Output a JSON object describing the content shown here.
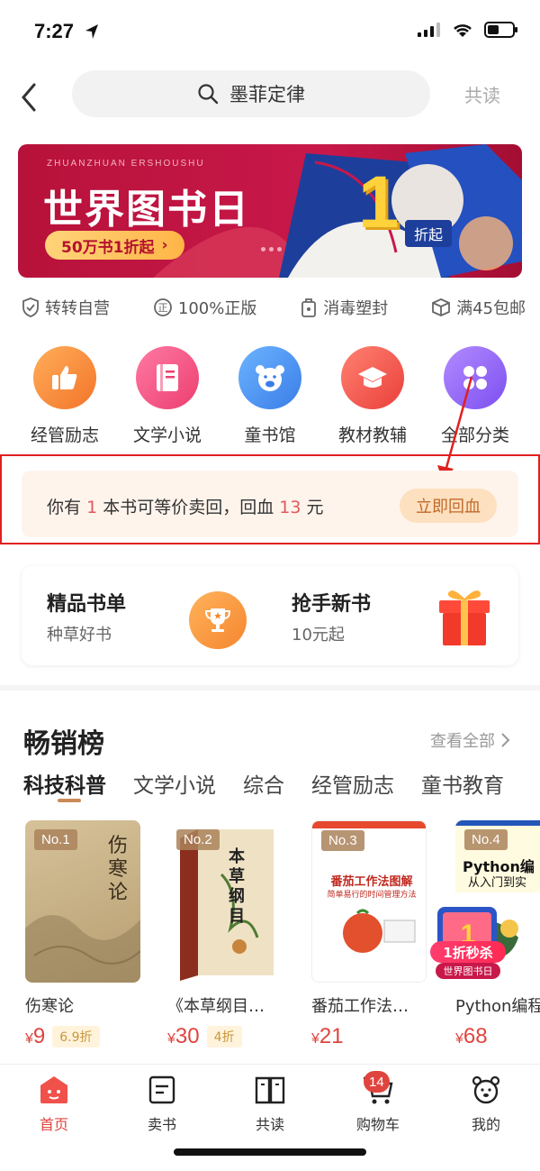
{
  "status_bar": {
    "time": "7:27"
  },
  "header": {
    "search_text": "墨菲定律",
    "right_label": "共读"
  },
  "banner": {
    "subtitle": "ZHUANZHUAN ERSHOUSHU",
    "title": "世界图书日",
    "pill_label": "50万书1折起",
    "big_number": "1",
    "discount_label": "折起"
  },
  "features": [
    {
      "label": "转转自营",
      "icon": "shield-check-icon"
    },
    {
      "label": "100%正版",
      "icon": "genuine-icon"
    },
    {
      "label": "消毒塑封",
      "icon": "seal-bag-icon"
    },
    {
      "label": "满45包邮",
      "icon": "package-icon"
    }
  ],
  "categories": [
    {
      "label": "经管励志",
      "icon": "thumbs-up-icon",
      "color": "#f5853a"
    },
    {
      "label": "文学小说",
      "icon": "book-icon",
      "color": "#f0457a"
    },
    {
      "label": "童书馆",
      "icon": "bear-icon",
      "color": "#3d8ef0"
    },
    {
      "label": "教材教辅",
      "icon": "graduation-cap-icon",
      "color": "#f0524a"
    },
    {
      "label": "全部分类",
      "icon": "grid-icon",
      "color": "#8a5cf0"
    }
  ],
  "resell": {
    "text_prefix": "你有",
    "count": "1",
    "text_middle": "本书可等价卖回，回血",
    "amount": "13",
    "text_suffix": "元",
    "button_label": "立即回血"
  },
  "promo": {
    "left_title": "精品书单",
    "left_sub": "种草好书",
    "right_title": "抢手新书",
    "right_sub": "10元起"
  },
  "ranking": {
    "title": "畅销榜",
    "view_all": "查看全部",
    "tabs": [
      "科技科普",
      "文学小说",
      "综合",
      "经管励志",
      "童书教育"
    ],
    "books": [
      {
        "rank": "No.1",
        "title": "伤寒论",
        "price": "9",
        "discount": "6.9折"
      },
      {
        "rank": "No.2",
        "title": "《本草纲目…",
        "price": "30",
        "discount": "4折"
      },
      {
        "rank": "No.3",
        "title": "番茄工作法…",
        "price": "21",
        "discount": ""
      },
      {
        "rank": "No.4",
        "title": "Python编程",
        "price": "68",
        "discount": ""
      }
    ],
    "currency": "¥"
  },
  "book_cover_text": {
    "b1": "伤寒论",
    "b2": "本草纲目",
    "b3_line1": "番茄工作法图解",
    "b3_line2": "简单易行的时间管理方法",
    "b4_line1": "Python编",
    "b4_line2": "从入门到实",
    "flash_sale": "1折秒杀",
    "flash_sale_sub": "世界图书日"
  },
  "bottom_nav": [
    {
      "label": "首页",
      "icon": "home-icon",
      "active": true
    },
    {
      "label": "卖书",
      "icon": "sell-book-icon"
    },
    {
      "label": "共读",
      "icon": "read-together-icon"
    },
    {
      "label": "购物车",
      "icon": "cart-icon",
      "badge": "14"
    },
    {
      "label": "我的",
      "icon": "profile-icon"
    }
  ],
  "colors": {
    "accent": "#e0443e",
    "brand_red": "#c8184a",
    "highlight": "#e02020"
  }
}
